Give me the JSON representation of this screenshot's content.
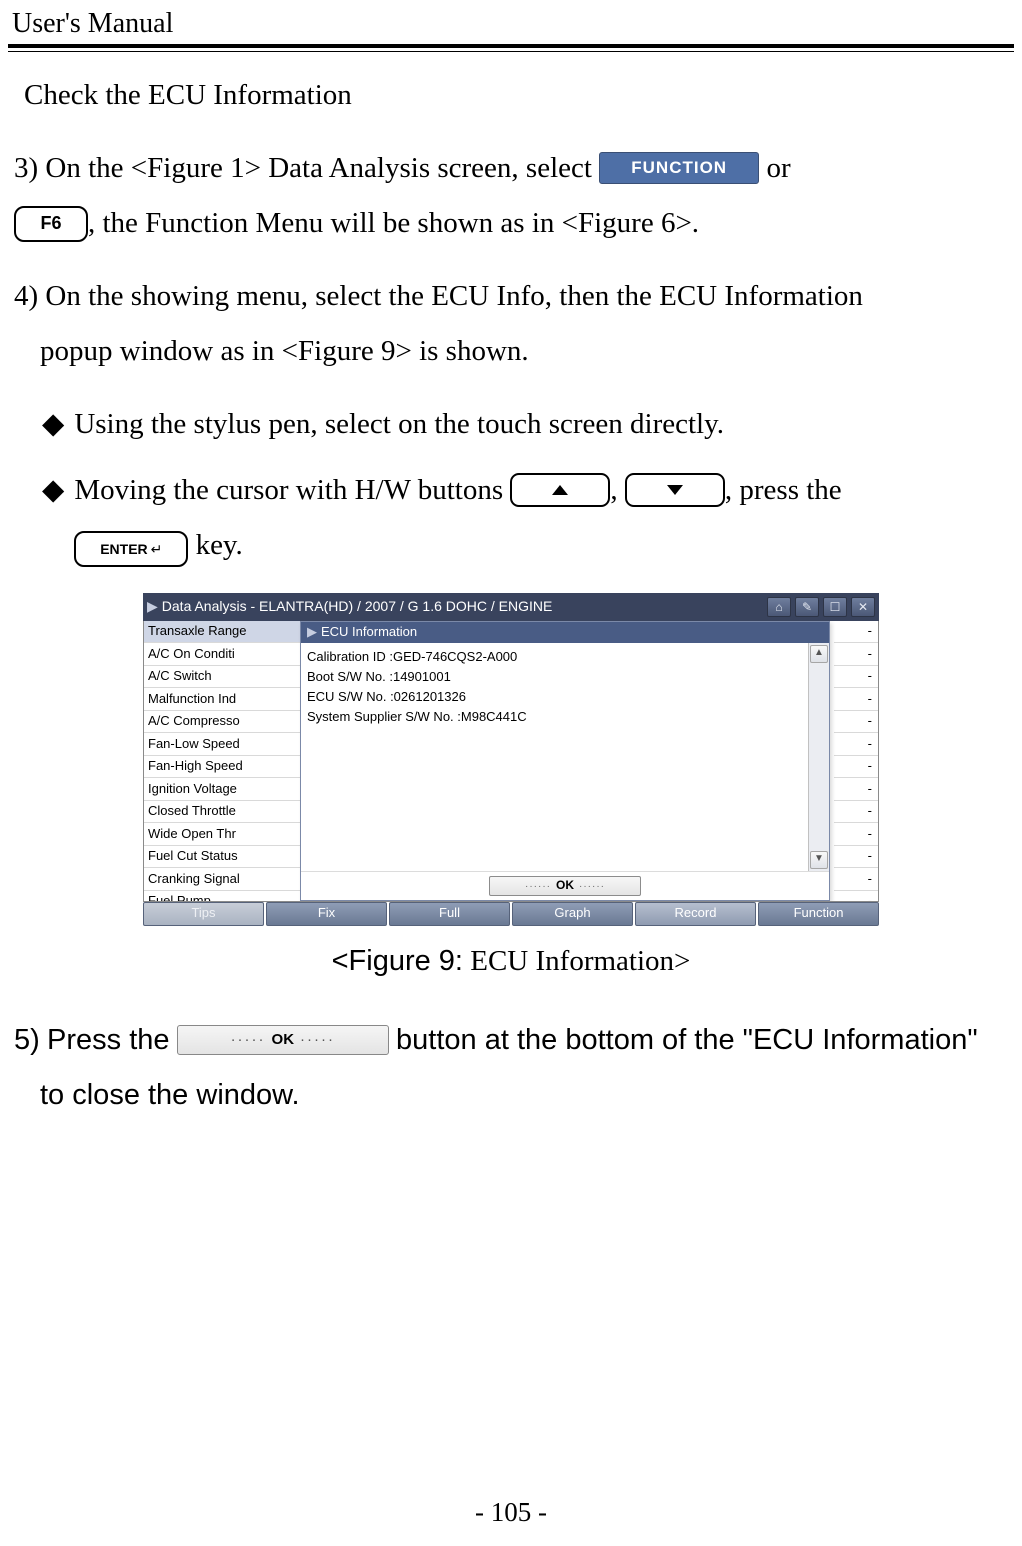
{
  "header": {
    "title": "User's Manual"
  },
  "section_heading": "Check the ECU Information",
  "step3": {
    "num": "3)",
    "pre": "On the <Figure 1> Data Analysis screen, select",
    "post_or": "or",
    "tail": ", the Function Menu will be shown as in <Figure 6>."
  },
  "buttons": {
    "function_label": "FUNCTION",
    "f6_label": "F6",
    "enter_label": "ENTER",
    "ok_label": "OK"
  },
  "step4": {
    "num": "4)",
    "line1": "On the showing menu, select the ECU Info, then the ECU Information",
    "line2": "popup window as in <Figure 9> is shown."
  },
  "bullets": {
    "b1": "Using the stylus pen, select on the touch screen directly.",
    "b2_pre": "Moving the cursor with H/W buttons",
    "b2_mid": ",",
    "b2_post": ", press the",
    "b2_tail": "key."
  },
  "figure": {
    "titlebar": "Data Analysis - ELANTRA(HD) / 2007 / G 1.6 DOHC / ENGINE",
    "left_items": [
      "Transaxle Range",
      "A/C On Conditi",
      "A/C Switch",
      "Malfunction Ind",
      "A/C Compresso",
      "Fan-Low Speed",
      "Fan-High Speed",
      "Ignition Voltage",
      "Closed Throttle",
      "Wide Open Thr",
      "Fuel Cut Status",
      "Cranking Signal",
      "Fuel Pump"
    ],
    "values": [
      "-",
      "-",
      "-",
      "-",
      "-",
      "-",
      "-",
      "-",
      "-",
      "-",
      "-",
      "-",
      "-"
    ],
    "popup_title": "ECU Information",
    "popup_lines": [
      "Calibration ID :GED-746CQS2-A000",
      "Boot S/W No. :14901001",
      "ECU S/W No. :0261201326",
      "System Supplier S/W No. :M98C441C"
    ],
    "bottom_buttons": [
      "Tips",
      "Fix",
      "Full",
      "Graph",
      "Record",
      "Function"
    ]
  },
  "caption": {
    "head": "<Figure 9:",
    "tail": "ECU Information>"
  },
  "step5": {
    "num": "5)",
    "pre": "Press the",
    "mid": "button at the bottom of the \"ECU Information\"",
    "tail": "to close the window."
  },
  "footer": "- 105 -"
}
